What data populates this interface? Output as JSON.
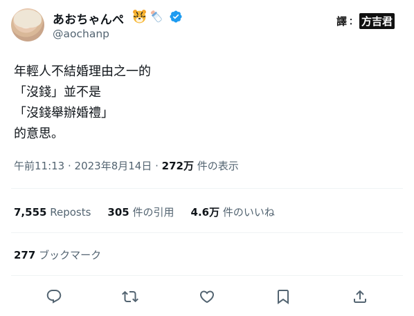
{
  "author": {
    "display_name": "あおちゃんぺ",
    "display_emojis": [
      "tiger-face-emoji",
      "baby-bottle-emoji"
    ],
    "handle": "@aochanp",
    "verified_badge_color": "#1d9bf0"
  },
  "watermark": {
    "left": "譯",
    "separator": "：",
    "right": "方吉君"
  },
  "tweet": {
    "lines": [
      "年輕人不結婚理由之一的",
      "「沒錢」並不是",
      "「沒錢舉辦婚禮」",
      "的意思。"
    ]
  },
  "meta": {
    "time": "午前11:13",
    "sep1": " · ",
    "date": "2023年8月14日",
    "sep2": " · ",
    "views_count": "272万",
    "views_label": " 件の表示"
  },
  "stats": {
    "reposts_count": "7,555",
    "reposts_label": " Reposts",
    "quotes_count": "305",
    "quotes_label": " 件の引用",
    "likes_count": "4.6万",
    "likes_label": " 件のいいね"
  },
  "bookmarks": {
    "count": "277",
    "label": " ブックマーク"
  },
  "actions": [
    "reply-icon",
    "repost-icon",
    "like-icon",
    "bookmark-icon",
    "share-icon"
  ],
  "colors": {
    "text": "#0f1419",
    "secondary": "#536471",
    "divider": "#eff3f4",
    "accent": "#1d9bf0"
  }
}
